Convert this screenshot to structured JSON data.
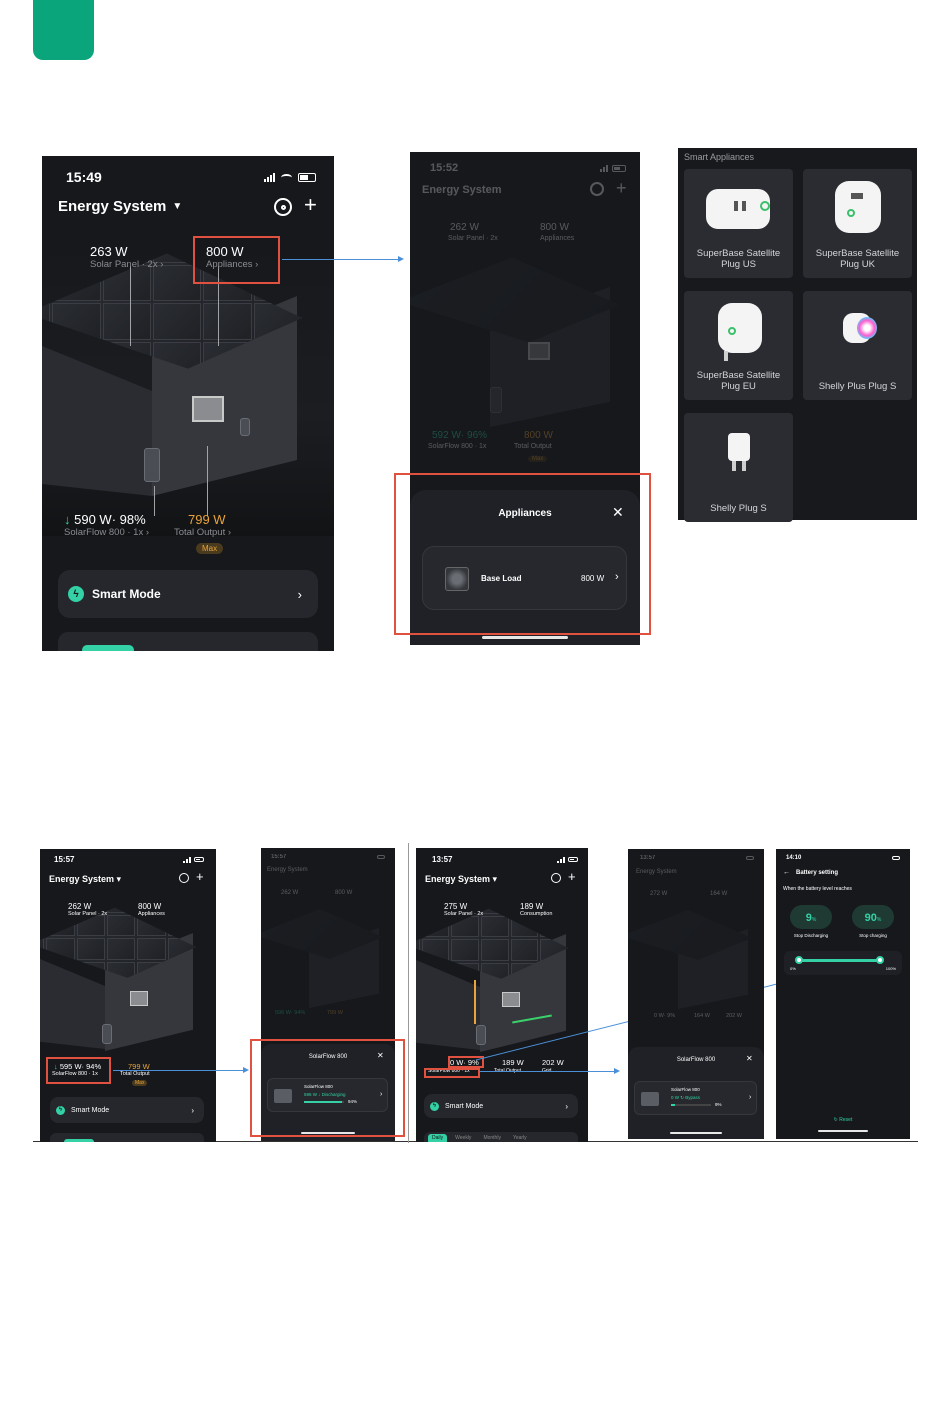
{
  "brand_tab_color": "#0aa57a",
  "phone1": {
    "time": "15:49",
    "title": "Energy System",
    "solar_value": "263 W",
    "solar_label": "Solar Panel · 2x",
    "appl_value": "800 W",
    "appl_label": "Appliances",
    "sf_value": "590 W· 98%",
    "sf_label": "SolarFlow 800 · 1x",
    "out_value": "799 W",
    "out_label": "Total Output",
    "max_badge": "Max",
    "smart_mode": "Smart Mode"
  },
  "phone2": {
    "time": "15:52",
    "title": "Energy System",
    "solar_value": "262 W",
    "solar_label": "Solar Panel · 2x",
    "appl_value": "800 W",
    "appl_label": "Appliances",
    "sf_value": "592 W· 96%",
    "sf_label": "SolarFlow 800 · 1x",
    "out_value": "800 W",
    "out_label": "Total Output",
    "max_badge": "Max",
    "sheet_title": "Appliances",
    "item_name": "Base Load",
    "item_value": "800 W"
  },
  "smart_appliances": {
    "title": "Smart Appliances",
    "items": [
      "SuperBase Satellite Plug US",
      "SuperBase Satellite Plug UK",
      "SuperBase Satellite Plug EU",
      "Shelly Plus Plug S",
      "Shelly Plug S"
    ]
  },
  "phone3": {
    "time": "15:57",
    "title": "Energy System",
    "solar_value": "262 W",
    "solar_label": "Solar Panel · 2x",
    "appl_value": "800 W",
    "appl_label": "Appliances",
    "sf_value": "595 W· 94%",
    "sf_label": "SolarFlow 800 · 1x",
    "out_value": "799 W",
    "out_label": "Total Output",
    "max_badge": "Max",
    "smart_mode": "Smart Mode"
  },
  "phone4": {
    "time": "15:57",
    "title": "Energy System",
    "solar_value": "262 W",
    "appl_value": "800 W",
    "sf_value": "596 W· 94%",
    "out_value": "799 W",
    "sheet_title": "SolarFlow 800",
    "device_name": "SolarFlow 800",
    "device_status_value": "596 W",
    "device_status": "Discharging",
    "device_pct": "94%"
  },
  "phone5": {
    "time": "13:57",
    "title": "Energy System",
    "solar_value": "275 W",
    "solar_label": "Solar Panel · 2x",
    "cons_value": "189 W",
    "cons_label": "Consumption",
    "sf_value": "0 W· 9%",
    "sf_label": "SolarFlow 800 · 1x",
    "out_value": "189 W",
    "out_label": "Total Output",
    "grid_value": "202 W",
    "grid_label": "Grid",
    "smart_mode": "Smart Mode",
    "tabs": [
      "Daily",
      "Weekly",
      "Monthly",
      "Yearly"
    ]
  },
  "phone6": {
    "time": "13:57",
    "title": "Energy System",
    "solar_value": "272 W",
    "cons_value": "164 W",
    "sf_value": "0 W· 9%",
    "out_value": "164 W",
    "grid_value": "202 W",
    "sheet_title": "SolarFlow 800",
    "device_name": "SolarFlow 800",
    "device_status_value": "0 W",
    "device_status": "Bypass",
    "device_pct": "9%"
  },
  "phone7": {
    "time": "14:10",
    "title": "Battery setting",
    "subtitle": "When the battery level reaches",
    "low_value": "9",
    "low_label": "Stop Discharging",
    "high_value": "90",
    "high_label": "Stop charging",
    "pct": "%",
    "range_min": "0%",
    "range_max": "100%",
    "slider_low": 0.09,
    "slider_high": 0.9,
    "reset": "Reset"
  }
}
